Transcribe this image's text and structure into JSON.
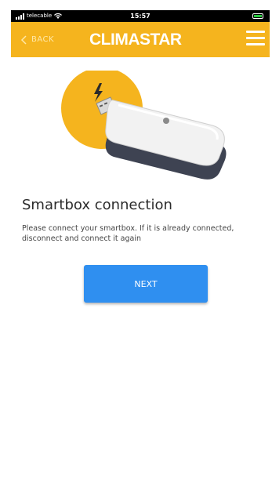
{
  "status_bar": {
    "carrier": "telecable",
    "time": "15:57"
  },
  "header": {
    "back_label": "BACK",
    "brand": "CLIMASTAR",
    "colors": {
      "background": "#f5b41e"
    }
  },
  "icons": {
    "back": "chevron-left-icon",
    "menu": "hamburger-menu-icon",
    "illustration": "smartbox-device-icon",
    "power": "lightning-bolt-icon"
  },
  "content": {
    "title": "Smartbox connection",
    "description": "Please connect your smartbox. If it is already connected, disconnect and connect it again",
    "next_label": "NEXT"
  },
  "colors": {
    "accent": "#f5b41e",
    "button": "#2f8ff0",
    "battery": "#27c93f"
  }
}
